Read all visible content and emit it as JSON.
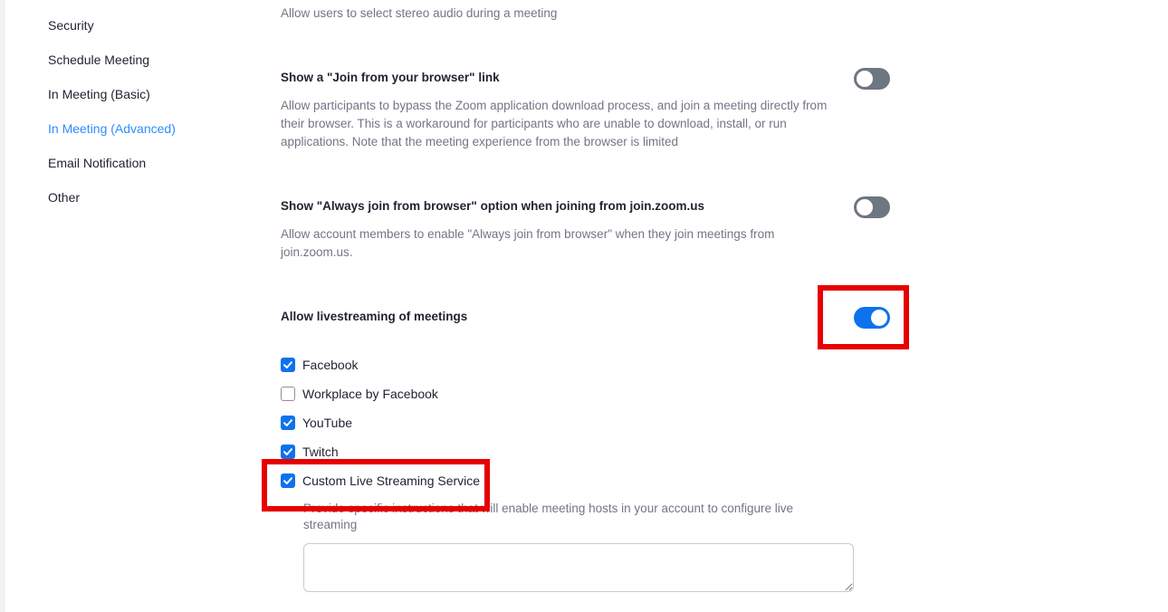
{
  "sidebar": {
    "items": [
      {
        "label": "Security"
      },
      {
        "label": "Schedule Meeting"
      },
      {
        "label": "In Meeting (Basic)"
      },
      {
        "label": "In Meeting (Advanced)",
        "active": true
      },
      {
        "label": "Email Notification"
      },
      {
        "label": "Other"
      }
    ]
  },
  "settings": {
    "stereo_desc": "Allow users to select stereo audio during a meeting",
    "join_browser": {
      "title": "Show a \"Join from your browser\" link",
      "desc": "Allow participants to bypass the Zoom application download process, and join a meeting directly from their browser. This is a workaround for participants who are unable to download, install, or run applications. Note that the meeting experience from the browser is limited",
      "enabled": false
    },
    "always_join": {
      "title": "Show \"Always join from browser\" option when joining from join.zoom.us",
      "desc": "Allow account members to enable \"Always join from browser\" when they join meetings from join.zoom.us.",
      "enabled": false
    },
    "livestream": {
      "title": "Allow livestreaming of meetings",
      "enabled": true,
      "options": [
        {
          "label": "Facebook",
          "checked": true
        },
        {
          "label": "Workplace by Facebook",
          "checked": false
        },
        {
          "label": "YouTube",
          "checked": true
        },
        {
          "label": "Twitch",
          "checked": true
        },
        {
          "label": "Custom Live Streaming Service",
          "checked": true
        }
      ],
      "custom_desc": "Provide specific instructions that will enable meeting hosts in your account to configure live streaming",
      "custom_instructions_value": ""
    }
  },
  "colors": {
    "accent": "#0e72ed",
    "sidebar_active": "#2d8cff",
    "highlight": "#e60000",
    "toggle_off": "#6e7680"
  },
  "icons": {
    "checkbox_checked": "checkmark-icon"
  }
}
